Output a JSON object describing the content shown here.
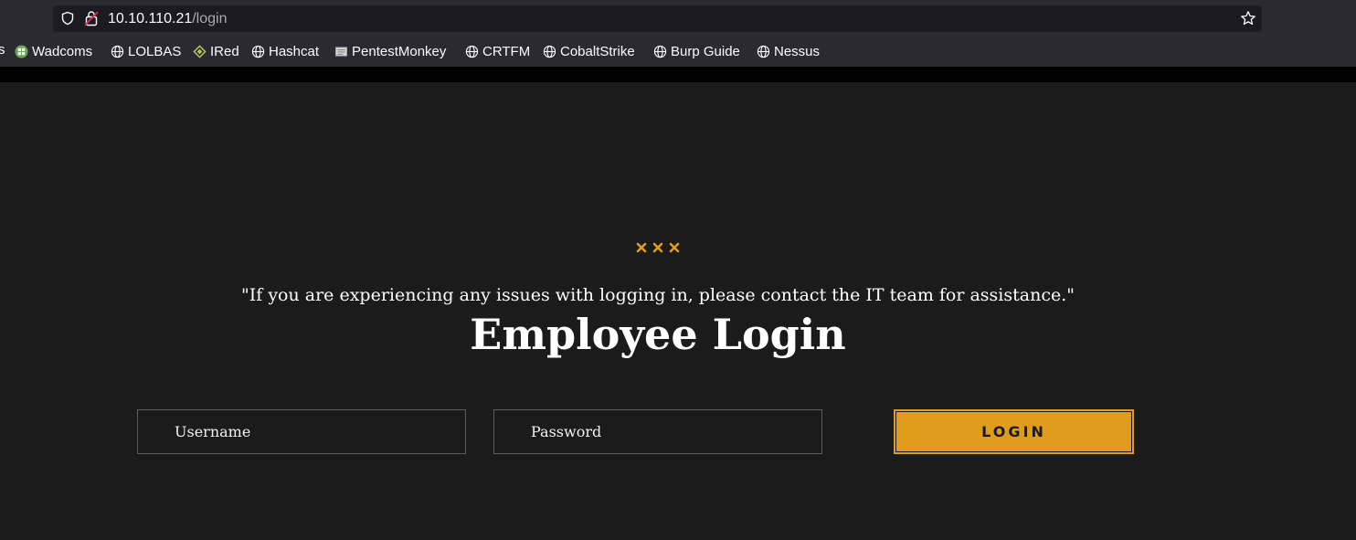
{
  "browser": {
    "url_host": "10.10.110.21",
    "url_path": "/login",
    "bookmarks_cutoff": "s",
    "bookmarks": [
      {
        "label": "Wadcoms",
        "icon": "wadcoms-icon"
      },
      {
        "label": "LOLBAS",
        "icon": "globe-icon"
      },
      {
        "label": "IRed",
        "icon": "ired-icon"
      },
      {
        "label": "Hashcat",
        "icon": "globe-icon"
      },
      {
        "label": "PentestMonkey",
        "icon": "pentestmonkey-icon"
      },
      {
        "label": "CRTFM",
        "icon": "globe-icon"
      },
      {
        "label": "CobaltStrike",
        "icon": "globe-icon"
      },
      {
        "label": "Burp Guide",
        "icon": "globe-icon"
      },
      {
        "label": "Nessus",
        "icon": "globe-icon"
      }
    ]
  },
  "login": {
    "notice": "\"If you are experiencing any issues with logging in, please contact the IT team for assistance.\"",
    "title": "Employee Login",
    "username_placeholder": "Username",
    "password_placeholder": "Password",
    "button_label": "LOGIN"
  },
  "colors": {
    "accent": "#e09c1c",
    "background": "#1b1b1b",
    "chrome": "#2b2a33"
  }
}
